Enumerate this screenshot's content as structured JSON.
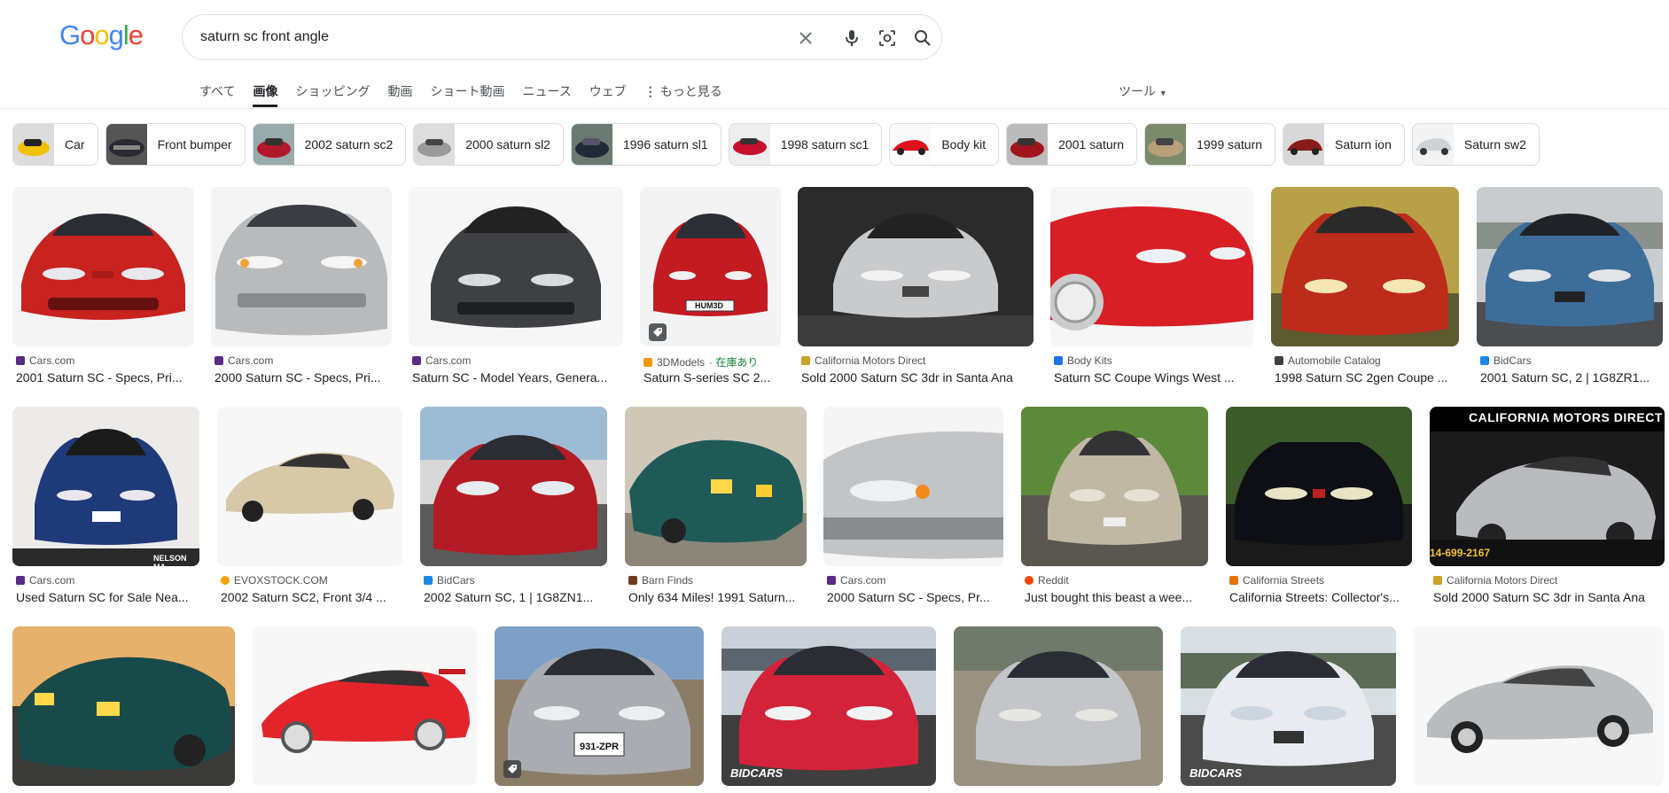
{
  "logo": "Google",
  "search": {
    "query": "saturn sc front angle"
  },
  "icons": {
    "clear": "close-icon",
    "voice": "microphone-icon",
    "lens": "camera-lens-icon",
    "search": "search-icon"
  },
  "tabs": [
    "すべて",
    "画像",
    "ショッピング",
    "動画",
    "ショート動画",
    "ニュース",
    "ウェブ",
    "もっと見る"
  ],
  "active_tab": "画像",
  "tools_label": "ツール",
  "chips": [
    "Car",
    "Front bumper",
    "2002 saturn sc2",
    "2000 saturn sl2",
    "1996 saturn sl1",
    "1998 saturn sc1",
    "Body kit",
    "2001 saturn",
    "1999 saturn",
    "Saturn ion",
    "Saturn sw2"
  ],
  "results": [
    {
      "source": "Cars.com",
      "title": "2001 Saturn SC - Specs, Pri..."
    },
    {
      "source": "Cars.com",
      "title": "2000 Saturn SC - Specs, Pri..."
    },
    {
      "source": "Cars.com",
      "title": "Saturn SC - Model Years, Genera..."
    },
    {
      "source": "3DModels",
      "source_extra": " · 在庫あり",
      "title": "Saturn S-series SC 2...",
      "plate": "HUM3D"
    },
    {
      "source": "California Motors Direct",
      "title": "Sold 2000 Saturn SC 3dr in Santa Ana"
    },
    {
      "source": "Body Kits",
      "title": "Saturn SC Coupe Wings West ..."
    },
    {
      "source": "Automobile Catalog",
      "title": "1998 Saturn SC 2gen Coupe ..."
    },
    {
      "source": "BidCars",
      "title": "2001 Saturn SC, 2 | 1G8ZR1..."
    },
    {
      "source": "Cars.com",
      "title": "Used Saturn SC for Sale Nea...",
      "overlay": "NELSON MA"
    },
    {
      "source": "EVOXSTOCK.COM",
      "title": "2002 Saturn SC2, Front 3/4 ..."
    },
    {
      "source": "BidCars",
      "title": "2002 Saturn SC, 1 | 1G8ZN1..."
    },
    {
      "source": "Barn Finds",
      "title": "Only 634 Miles! 1991 Saturn..."
    },
    {
      "source": "Cars.com",
      "title": "2000 Saturn SC - Specs, Pr..."
    },
    {
      "source": "Reddit",
      "title": "Just bought this beast a wee..."
    },
    {
      "source": "California Streets",
      "title": "California Streets: Collector's..."
    },
    {
      "source": "California Motors Direct",
      "title": "Sold 2000 Saturn SC 3dr in Santa Ana",
      "overlay": "CALIFORNIA MOTORS DIRECT",
      "overlay2": "14-699-2167"
    },
    {
      "plate": "931-ZPR"
    },
    {
      "watermark": "BIDCARS"
    },
    {
      "watermark": "BIDCARS"
    }
  ],
  "colors": {
    "favicon_cars": "#5b2a86",
    "favicon_3d": "#f29900",
    "favicon_cmd": "#c9a227",
    "favicon_bodykits": "#1a73e8",
    "favicon_autocat": "#3c4043",
    "favicon_bidcars": "#1e88e5",
    "favicon_evox": "#f4a300",
    "favicon_barn": "#6d3b1e",
    "favicon_reddit": "#ff4500",
    "favicon_cs": "#e8710a"
  }
}
